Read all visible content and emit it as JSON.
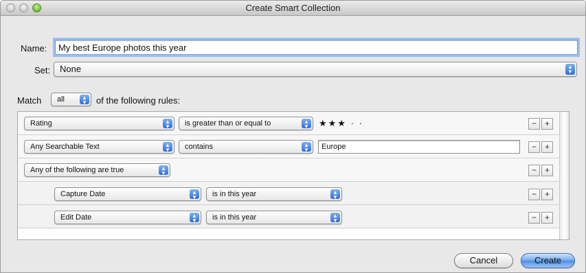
{
  "window": {
    "title": "Create Smart Collection"
  },
  "form": {
    "name_label": "Name:",
    "name_value": "My best Europe photos this year",
    "set_label": "Set:",
    "set_value": "None",
    "match_prefix": "Match",
    "match_value": "all",
    "match_suffix": "of the following rules:"
  },
  "rules": [
    {
      "field": "Rating",
      "operator": "is greater than or equal to",
      "rating_value": 3,
      "rating_display": "★★★ · ·"
    },
    {
      "field": "Any Searchable Text",
      "operator": "contains",
      "text": "Europe"
    },
    {
      "field": "Any of the following are true"
    },
    {
      "field": "Capture Date",
      "operator": "is in this year"
    },
    {
      "field": "Edit Date",
      "operator": "is in this year"
    }
  ],
  "controls": {
    "minus": "−",
    "plus": "+"
  },
  "buttons": {
    "cancel": "Cancel",
    "create": "Create"
  }
}
